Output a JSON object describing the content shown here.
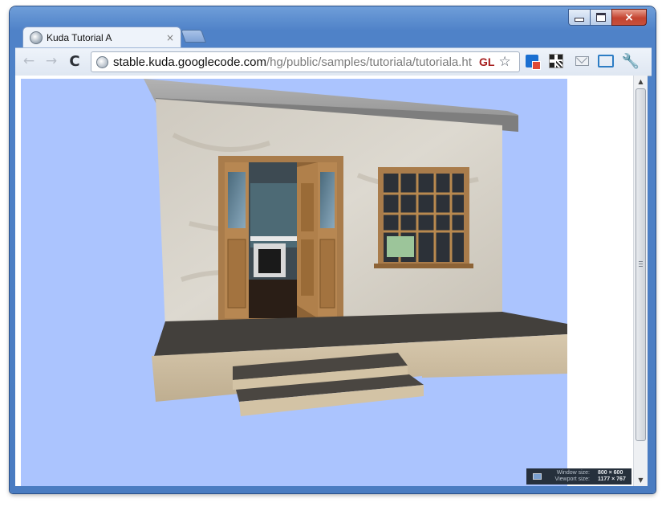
{
  "tab": {
    "title": "Kuda Tutorial A",
    "close_glyph": "×"
  },
  "window_controls": {
    "minimize": "minimize-icon",
    "maximize": "maximize-icon",
    "close_glyph": "×"
  },
  "toolbar": {
    "back_glyph": "←",
    "forward_glyph": "→",
    "reload_glyph": "C",
    "url_host": "stable.kuda.googlecode.com",
    "url_path": "/hg/public/samples/tutoriala/tutoriala.ht",
    "gl_badge": "GL",
    "star_glyph": "☆",
    "wrench_glyph": "🔧",
    "extensions": [
      "translate-icon",
      "qr-code-icon",
      "mail-icon",
      "fullscreen-icon"
    ]
  },
  "resize_overlay": {
    "window_label": "Window size:",
    "window_value": "800 × 600",
    "viewport_label": "Viewport size:",
    "viewport_value": "1177 × 767"
  },
  "colors": {
    "frame": "#4f82c8",
    "canvas_sky": "#abc4fe",
    "gl_badge": "#a51d1d"
  }
}
